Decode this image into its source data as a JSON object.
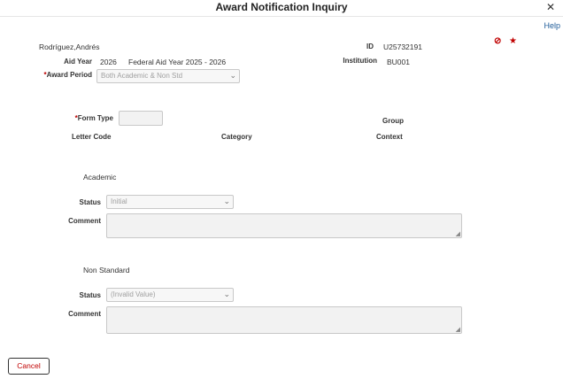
{
  "window": {
    "title": "Award Notification Inquiry",
    "close": "✕",
    "help": "Help"
  },
  "student": {
    "name": "Rodríguez,Andrés",
    "id_label": "ID",
    "id_value": "U25732191",
    "aid_year_label": "Aid Year",
    "aid_year_value": "2026",
    "aid_year_desc": "Federal Aid Year 2025 - 2026",
    "institution_label": "Institution",
    "institution_value": "BU001"
  },
  "icons": {
    "no_entry": "⊘",
    "star": "★"
  },
  "award_period": {
    "required_mark": "*",
    "label": "Award Period",
    "value": "Both Academic & Non Std"
  },
  "form_type": {
    "required_mark": "*",
    "label": "Form Type",
    "value": "",
    "group_label": "Group",
    "letter_code_label": "Letter Code",
    "category_label": "Category",
    "context_label": "Context"
  },
  "academic": {
    "heading": "Academic",
    "status_label": "Status",
    "status_value": "Initial",
    "comment_label": "Comment"
  },
  "non_standard": {
    "heading": "Non Standard",
    "status_label": "Status",
    "status_value": "(Invalid Value)",
    "comment_label": "Comment"
  },
  "actions": {
    "cancel": "Cancel"
  },
  "colors": {
    "link": "#1f5c99",
    "cancel_text": "#c00000",
    "icon_red": "#c00000"
  }
}
